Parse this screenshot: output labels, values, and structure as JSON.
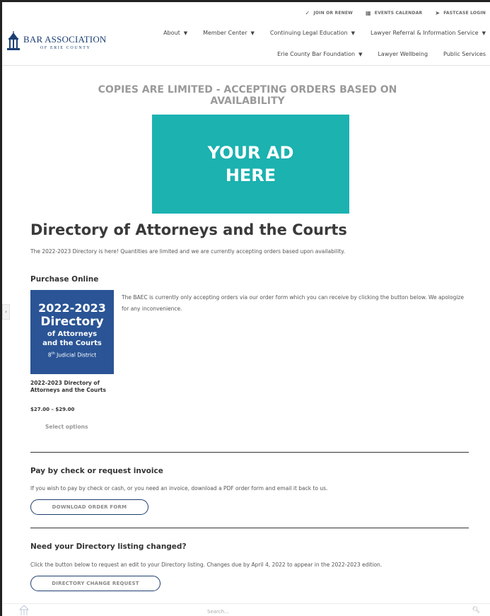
{
  "utility": {
    "join": "JOIN OR RENEW",
    "events": "EVENTS CALENDAR",
    "fastcase": "FASTCASE LOGIN"
  },
  "logo": {
    "line1": "BAR ASSOCIATION",
    "line2": "OF ERIE COUNTY"
  },
  "nav": {
    "row1": [
      "About",
      "Member Center",
      "Continuing Legal Education",
      "Lawyer Referral & Information Service"
    ],
    "row2": [
      "Erie County Bar Foundation",
      "Lawyer Wellbeing",
      "Public Services"
    ]
  },
  "notice": "COPIES ARE LIMITED - ACCEPTING ORDERS BASED ON AVAILABILITY",
  "ad": {
    "line1": "YOUR AD",
    "line2": "HERE"
  },
  "page": {
    "title": "Directory of Attorneys and the Courts",
    "intro": "The 2022-2023 Directory is here! Quantities are limited and we are currently accepting orders based upon availability."
  },
  "purchase": {
    "heading": "Purchase Online",
    "text": "The BAEC is currently only accepting orders via our order form which you can receive by clicking the button below. We apologize for any inconvenience.",
    "book": {
      "years": "2022-2023",
      "word": "Directory",
      "line3": "of Attorneys",
      "line4": "and the Courts",
      "district_num": "8",
      "district_sup": "th",
      "district_rest": " Judicial District"
    },
    "product_name": "2022-2023 Directory of Attorneys and the Courts",
    "price": "$27.00 – $29.00",
    "select_label": "Select options"
  },
  "check": {
    "heading": "Pay by check or request invoice",
    "text": "If you wish to pay by check or cash, or you need an invoice, download a PDF order form and email it back to us.",
    "button": "DOWNLOAD ORDER FORM"
  },
  "change": {
    "heading": "Need your Directory listing changed?",
    "text": "Click the button below to request an edit to your Directory listing. Changes due by April 4, 2022 to appear in the 2022-2023 edition.",
    "button": "DIRECTORY CHANGE REQUEST"
  },
  "sidetab": "›",
  "search": {
    "placeholder": "Search..."
  },
  "colors": {
    "accent": "#1bb2b0",
    "navy": "#1c3f73",
    "book": "#2a5495"
  }
}
